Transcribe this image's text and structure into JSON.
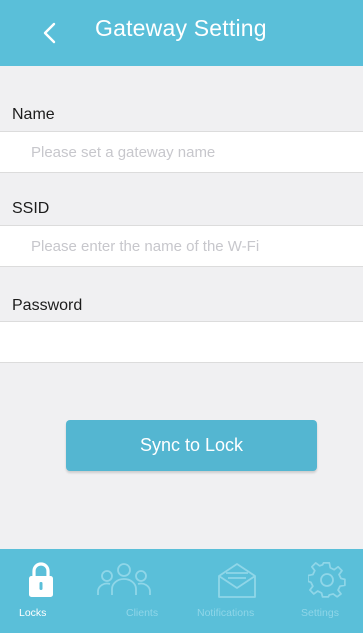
{
  "header": {
    "title": "Gateway Setting",
    "back_icon": "chevron-left-icon"
  },
  "form": {
    "name": {
      "label": "Name",
      "value": "",
      "placeholder": "Please set a gateway name"
    },
    "ssid": {
      "label": "SSID",
      "value": "",
      "placeholder": "Please enter the name of the W-Fi"
    },
    "password": {
      "label": "Password",
      "value": "",
      "placeholder": ""
    }
  },
  "sync_button": {
    "label": "Sync to Lock"
  },
  "tabbar": {
    "active_tab": "Locks",
    "tabs": [
      {
        "label": "Locks",
        "icon": "lock-icon"
      },
      {
        "label": "Clients",
        "icon": "users-icon"
      },
      {
        "label": "Notifications",
        "icon": "envelope-icon"
      },
      {
        "label": "Settings",
        "icon": "gear-icon"
      }
    ]
  },
  "colors": {
    "accent": "#5abfd9",
    "button": "#54b6d1",
    "background": "#f0f0f2",
    "inactive_tab": "#8fd6e8"
  }
}
